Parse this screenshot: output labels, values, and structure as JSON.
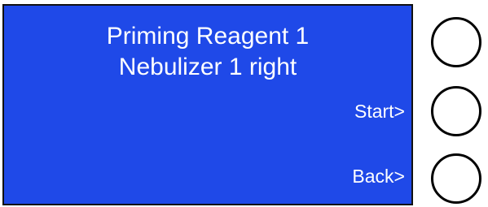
{
  "display": {
    "title_line1": "Priming Reagent 1",
    "title_line2": "Nebulizer 1 right",
    "start_label": "Start>",
    "back_label": "Back>"
  },
  "colors": {
    "screen_background": "#1f49e8",
    "text": "#ffffff",
    "button_outline": "#000000"
  },
  "hardware_buttons": [
    "top-softkey",
    "middle-softkey",
    "bottom-softkey"
  ]
}
